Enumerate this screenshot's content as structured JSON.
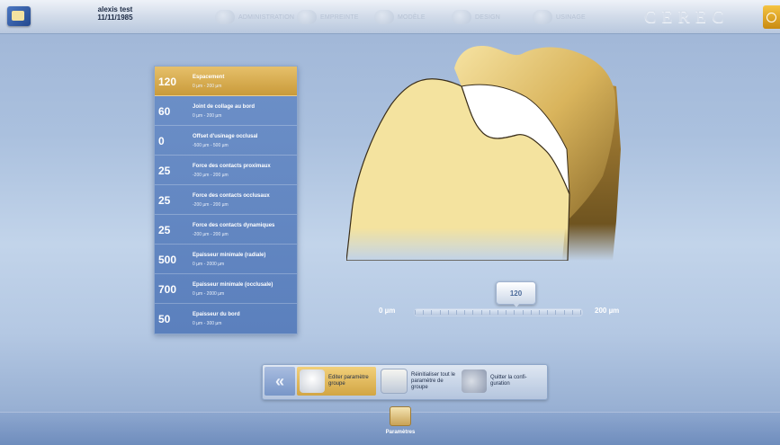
{
  "header": {
    "patient_name": "alexis test",
    "patient_date": "11/11/1985",
    "steps": [
      {
        "label": "ADMINISTRATION",
        "icon": "administration-icon"
      },
      {
        "label": "EMPREINTE",
        "icon": "scan-icon"
      },
      {
        "label": "MODÈLE",
        "icon": "model-icon"
      },
      {
        "label": "DESIGN",
        "icon": "design-icon"
      },
      {
        "label": "USINAGE",
        "icon": "milling-icon"
      }
    ],
    "brand": "CEREC"
  },
  "params": [
    {
      "value": "120",
      "name": "Espacement",
      "range": "0 µm - 200 µm",
      "selected": true
    },
    {
      "value": "60",
      "name": "Joint de collage au bord",
      "range": "0 µm - 200 µm",
      "selected": false
    },
    {
      "value": "0",
      "name": "Offset d'usinage occlusal",
      "range": "-500 µm - 500 µm",
      "selected": false
    },
    {
      "value": "25",
      "name": "Force des contacts proximaux",
      "range": "-200 µm - 200 µm",
      "selected": false
    },
    {
      "value": "25",
      "name": "Force des contacts occlusaux",
      "range": "-200 µm - 200 µm",
      "selected": false
    },
    {
      "value": "25",
      "name": "Force des contacts dynamiques",
      "range": "-200 µm - 200 µm",
      "selected": false
    },
    {
      "value": "500",
      "name": "Epaisseur minimale (radiale)",
      "range": "0 µm - 2000 µm",
      "selected": false
    },
    {
      "value": "700",
      "name": "Epaisseur minimale (occlusale)",
      "range": "0 µm - 2000 µm",
      "selected": false
    },
    {
      "value": "50",
      "name": "Epaisseur du bord",
      "range": "0 µm - 300 µm",
      "selected": false
    }
  ],
  "slider": {
    "min_label": "0 µm",
    "max_label": "200 µm",
    "value": 120,
    "value_label": "120",
    "min": 0,
    "max": 200
  },
  "actions": {
    "edit_group": "Editer paramètre groupe",
    "reset_all": "Réinitialiser tout le paramètre de groupe",
    "quit_config": "Quitter la confi-guration"
  },
  "footer": {
    "params_tab": "Paramètres"
  },
  "colors": {
    "selected_row": "#d9ac4f",
    "row_bg": "#6287c2",
    "tooth_main": "#f3df97",
    "tooth_dark": "#c9a44a"
  }
}
